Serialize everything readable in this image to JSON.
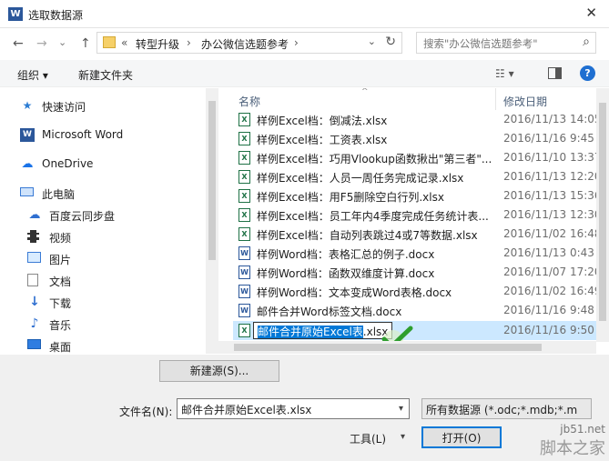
{
  "window": {
    "title": "选取数据源",
    "app_badge": "W",
    "close": "✕"
  },
  "nav_buttons": {
    "back": "←",
    "forward": "→",
    "recent": "⌄",
    "up": "↑"
  },
  "address": {
    "overflow": "«",
    "crumbs": [
      "转型升级",
      "办公微信选题参考"
    ],
    "sep": "›"
  },
  "search": {
    "placeholder": "搜索\"办公微信选题参考\""
  },
  "toolbar": {
    "organize": "组织 ▾",
    "new_folder": "新建文件夹",
    "help": "?"
  },
  "sidebar": {
    "items": [
      {
        "label": "快速访问",
        "icon": "star-icon"
      },
      {
        "label": "Microsoft Word",
        "icon": "word-icon"
      },
      {
        "label": "OneDrive",
        "icon": "cloud-icon"
      },
      {
        "label": "此电脑",
        "icon": "computer-icon"
      },
      {
        "label": "百度云同步盘",
        "icon": "baidu-cloud-icon"
      },
      {
        "label": "视频",
        "icon": "video-icon"
      },
      {
        "label": "图片",
        "icon": "pictures-icon"
      },
      {
        "label": "文档",
        "icon": "documents-icon"
      },
      {
        "label": "下载",
        "icon": "download-icon"
      },
      {
        "label": "音乐",
        "icon": "music-icon"
      },
      {
        "label": "桌面",
        "icon": "desktop-icon"
      }
    ]
  },
  "columns": {
    "name": "名称",
    "date": "修改日期"
  },
  "files": [
    {
      "name": "样例Excel档：倒减法.xlsx",
      "date": "2016/11/13 14:05",
      "type": "x"
    },
    {
      "name": "样例Excel档：工资表.xlsx",
      "date": "2016/11/16 9:45",
      "type": "x"
    },
    {
      "name": "样例Excel档：巧用Vlookup函数揪出\"第三者\"...",
      "date": "2016/11/10 13:37",
      "type": "x"
    },
    {
      "name": "样例Excel档：人员一周任务完成记录.xlsx",
      "date": "2016/11/13 12:20",
      "type": "x"
    },
    {
      "name": "样例Excel档：用F5删除空白行列.xlsx",
      "date": "2016/11/13 15:36",
      "type": "x"
    },
    {
      "name": "样例Excel档：员工年内4季度完成任务统计表...",
      "date": "2016/11/13 12:30",
      "type": "x"
    },
    {
      "name": "样例Excel档：自动列表跳过4或7等数据.xlsx",
      "date": "2016/11/02 16:48",
      "type": "x"
    },
    {
      "name": "样例Word档：表格汇总的例子.docx",
      "date": "2016/11/13 0:43",
      "type": "w"
    },
    {
      "name": "样例Word档：函数双维度计算.docx",
      "date": "2016/11/07 17:20",
      "type": "w"
    },
    {
      "name": "样例Word档：文本变成Word表格.docx",
      "date": "2016/11/02 16:49",
      "type": "w"
    },
    {
      "name": "邮件合并Word标签文档.docx",
      "date": "2016/11/16 9:48",
      "type": "w"
    }
  ],
  "selected_file": {
    "name_highlight": "邮件合并原始Excel表",
    "name_ext": ".xlsx",
    "date": "2016/11/16 9:50"
  },
  "bottom": {
    "new_source": "新建源(S)...",
    "filename_label": "文件名(N):",
    "filename_value": "邮件合并原始Excel表.xlsx",
    "filter_value": "所有数据源 (*.odc;*.mdb;*.m",
    "tools": "工具(L)",
    "open": "打开(O)"
  },
  "watermark": {
    "line1": "jb51.net",
    "line2": "脚本之家"
  }
}
